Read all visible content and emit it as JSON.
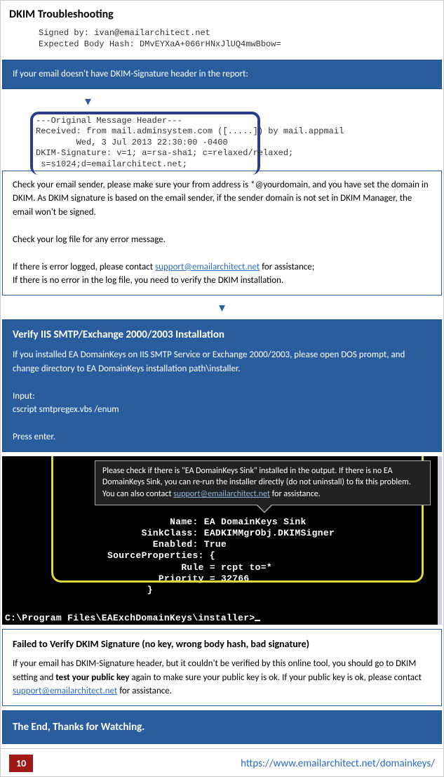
{
  "title": "DKIM Troubleshooting",
  "snip1_l1": "Signed by: ivan@emailarchitect.net",
  "snip1_l2": "Expected Body Hash: DMvEYXaA+066rHNxJlUQ4mwBbow=",
  "box_no_sig": "If your email doesn't have DKIM-Signature header in the report:",
  "orig_header": "---Original Message Header---\nReceived: from mail.adminsystem.com ([.....]) by mail.appmail\n        Wed, 3 Jul 2013 22:30:00 -0400\nDKIM-Signature: v=1; a=rsa-sha1; c=relaxed/relaxed;\n s=s1024;d=emailarchitect.net;",
  "check_sender_p1": "Check your email sender, please make sure your from address is *@yourdomain, and you have set the domain in DKIM. As DKIM signature is based on the email sender, if the sender domain is not set in DKIM Manager, the email won't be signed.",
  "check_sender_p2": "Check your log file for any error message.",
  "check_sender_p3a": "If there is error logged, please contact ",
  "check_sender_p3b": " for assistance;",
  "check_sender_p4": "If there is no error in the log file, you need to verify the DKIM installation.",
  "support_email": "support@emailarchitect.net",
  "verify_iis_title": "Verify IIS SMTP/Exchange 2000/2003 Installation",
  "verify_iis_p1": "If you installed EA DomainKeys on IIS SMTP Service or Exchange 2000/2003, please open DOS prompt, and change directory to EA DomainKeys installation path\\installer.",
  "verify_iis_p2": "Input:",
  "verify_iis_cmd": "cscript smtpregex.vbs /enum",
  "verify_iis_p3": "Press enter.",
  "callout_t1": "Please check if there is \"EA DomainKeys Sink\" installed in the output. If there is no EA DomainKeys Sink, you can re-run the installer directly (do not uninstall) to fix this problem. You can also contact ",
  "callout_t2": " for assistance.",
  "console": "           Name: EA DomainKeys Sink\n      SinkClass: EADKIMMgrObj.DKIMSigner\n        Enabled: True\nSourceProperties: {\n             Rule = rcpt to=*\n         Priority = 32766\n       }",
  "console_prompt": "C:\\Program Files\\EAExchDomainKeys\\installer>",
  "failed_title": "Failed to Verify DKIM Signature (no key, wrong body hash, bad signature)",
  "failed_p1a": "If your email has DKIM-Signature header, but it couldn't be verified by this online tool, you should go to DKIM setting and ",
  "failed_bold": "test your public key",
  "failed_p1b": " again to make sure your public key is ok. If your public key is ok, please contact ",
  "failed_p1c": " for assistance.",
  "end_box": "The End, Thanks for Watching.",
  "page_num": "10",
  "footer_url": "https://www.emailarchitect.net/domainkeys/"
}
